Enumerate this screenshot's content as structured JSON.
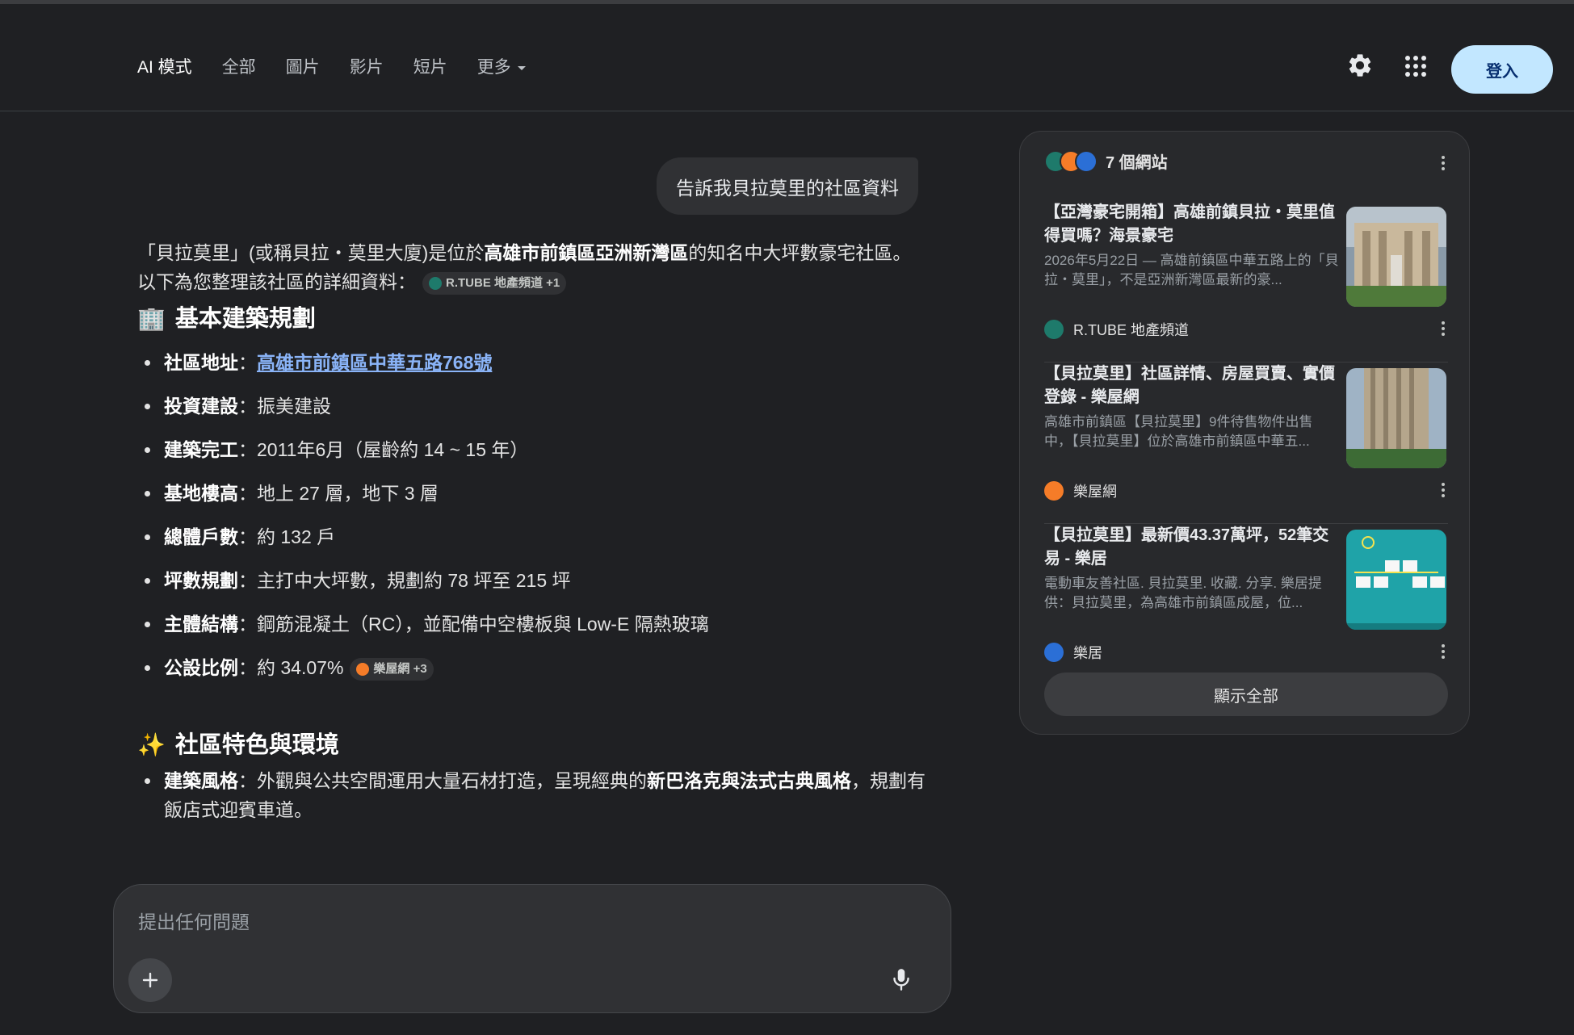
{
  "header": {
    "tabs": [
      {
        "label": "AI 模式",
        "active": true
      },
      {
        "label": "全部"
      },
      {
        "label": "圖片"
      },
      {
        "label": "影片"
      },
      {
        "label": "短片"
      },
      {
        "label": "更多"
      }
    ],
    "settings_icon": "gear-icon",
    "apps_icon": "apps-grid-icon",
    "login_label": "登入"
  },
  "conversation": {
    "user_query": "告訴我貝拉莫里的社區資料",
    "intro": {
      "part1": "「貝拉莫里」(或稱貝拉・莫里大廈)是位於",
      "bold1": "高雄市前鎮區亞洲新灣區",
      "part2": "的知名中大坪數豪宅社區。以下為您整理該社區的詳細資料：",
      "chip": "R.TUBE 地產頻道 +1"
    },
    "section1": {
      "emoji": "🏢",
      "title": "基本建築規劃",
      "items": [
        {
          "label": "社區地址",
          "sep": "：",
          "link": "高雄市前鎮區中華五路768號"
        },
        {
          "label": "投資建設",
          "sep": "：",
          "value": "振美建設"
        },
        {
          "label": "建築完工",
          "sep": "：",
          "value": "2011年6月（屋齡約 14 ~ 15 年）"
        },
        {
          "label": "基地樓高",
          "sep": "：",
          "value": "地上 27 層，地下 3 層"
        },
        {
          "label": "總體戶數",
          "sep": "：",
          "value": "約 132 戶"
        },
        {
          "label": "坪數規劃",
          "sep": "：",
          "value": "主打中大坪數，規劃約 78 坪至 215 坪"
        },
        {
          "label": "主體結構",
          "sep": "：",
          "value": "鋼筋混凝土（RC），並配備中空樓板與 Low-E 隔熱玻璃"
        },
        {
          "label": "公設比例",
          "sep": "：",
          "value": "約 34.07%",
          "chip": "樂屋網 +3"
        }
      ]
    },
    "section2": {
      "emoji": "✨",
      "title": "社區特色與環境",
      "item1": {
        "label": "建築風格",
        "sep": "：",
        "part1": "外觀與公共空間運用大量石材打造，呈現經典的",
        "bold": "新巴洛克與法式古典風格",
        "part2": "，規劃有飯店式迎賓車道。"
      }
    }
  },
  "composer": {
    "placeholder": "提出任何問題",
    "plus_icon": "plus-icon",
    "mic_icon": "mic-icon"
  },
  "sources": {
    "title": "7 個網站",
    "cards": [
      {
        "title": "【亞灣豪宅開箱】高雄前鎮貝拉・莫里值得買嗎？海景豪宅",
        "snippet": "2026年5月22日 — 高雄前鎮區中華五路上的「貝拉・莫里」，不是亞洲新灣區最新的豪...",
        "source": "R.TUBE 地產頻道",
        "color": "#1e7a6b"
      },
      {
        "title": "【貝拉莫里】社區詳情、房屋買賣、實價登錄 - 樂屋網",
        "snippet": "高雄市前鎮區【貝拉莫里】9件待售物件出售中，【貝拉莫里】位於高雄市前鎮區中華五...",
        "source": "樂屋網",
        "color": "#f57c28"
      },
      {
        "title": "【貝拉莫里】最新價43.37萬坪，52筆交易 - 樂居",
        "snippet": "電動車友善社區. 貝拉莫里. 收藏. 分享. 樂居提供：貝拉莫里，為高雄市前鎮區成屋，位...",
        "source": "樂居",
        "color": "#2b6fd6"
      }
    ],
    "show_all": "顯示全部"
  }
}
